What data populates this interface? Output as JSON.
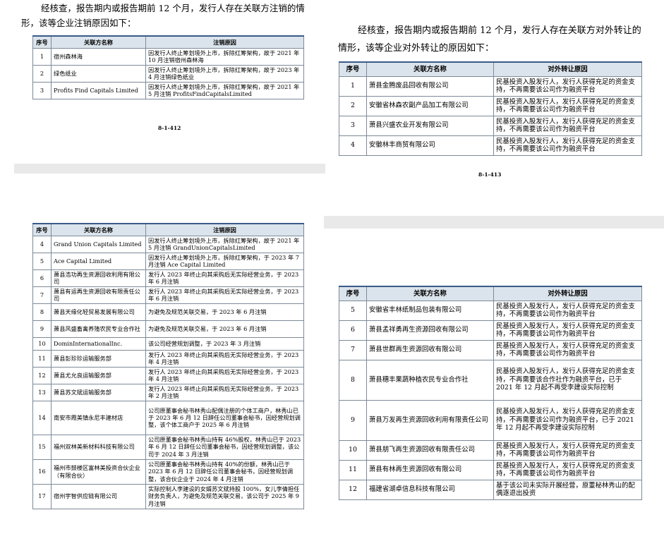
{
  "page_top_left": {
    "intro": "经核查，报告期内或报告期前 12 个月，发行人存在关联方注销的情形，该等企业注销原因如下：",
    "headers": [
      "序号",
      "关联方名称",
      "注销原因"
    ],
    "rows": [
      [
        "1",
        "宿州森林海",
        "因发行人终止筹划境外上市，拆除红筹架构，故于 2021 年 10 月注销宿州森林海"
      ],
      [
        "2",
        "绿色纸业",
        "因发行人终止筹划境外上市，拆除红筹架构，故于 2023 年 4 月注销绿色纸业"
      ],
      [
        "3",
        "Profits Find Capitals Limited",
        "因发行人终止筹划境外上市，拆除红筹架构，故于 2021 年 5 月注销 ProfitsFindCapitalsLimited"
      ]
    ],
    "page_number": "8-1-412"
  },
  "page_top_right": {
    "intro": "经核查，报告期内或报告期前 12 个月，发行人存在关联方对外转让的情形，该等企业对外转让的原因如下：",
    "headers": [
      "序号",
      "关联方名称",
      "对外转让原因"
    ],
    "rows": [
      [
        "1",
        "萧县金腾废品回收有限公司",
        "民基投资入股发行人，发行人获得充足的资金支持，不再需要该公司作为融资平台"
      ],
      [
        "2",
        "安徽省林森农副产品加工有限公司",
        "民基投资入股发行人，发行人获得充足的资金支持，不再需要该公司作为融资平台"
      ],
      [
        "3",
        "萧县兴盛农业开发有限公司",
        "民基投资入股发行人，发行人获得充足的资金支持，不再需要该公司作为融资平台"
      ],
      [
        "4",
        "安徽林丰商贸有限公司",
        "民基投资入股发行人，发行人获得充足的资金支持，不再需要该公司作为融资平台"
      ]
    ],
    "page_number": "8-1-413"
  },
  "page_bottom_left": {
    "headers": [
      "序号",
      "关联方名称",
      "注销原因"
    ],
    "rows": [
      [
        "4",
        "Grand Union Capitals Limited",
        "因发行人终止筹划境外上市，拆除红筹架构，故于 2021 年 5 月注销 GrandUnionCapitalsLimited"
      ],
      [
        "5",
        "Ace Capital Limited",
        "因发行人终止筹划境外上市，拆除红筹架构，于 2023 年 7 月注销 Ace Capital Limited"
      ],
      [
        "6",
        "萧县浩功再生资源回收利用有限公司",
        "发行人 2023 年终止向其采购后无实际经营业务，于 2023 年 6 月注销"
      ],
      [
        "7",
        "萧县有运再生资源回收有限责任公司",
        "发行人 2023 年终止向其采购后无实际经营业务，于 2023 年 6 月注销"
      ],
      [
        "8",
        "萧县天缘化轻贸易发展有限公司",
        "为避免及规范关联交易，于 2023 年 6 月注销"
      ],
      [
        "9",
        "萧县风盛畜禽养殖农民专业合作社",
        "为避免及规范关联交易，于 2023 年 6 月注销"
      ],
      [
        "10",
        "DominInternationalInc.",
        "该公司经营规划调整，于 2023 年 3 月注销"
      ],
      [
        "11",
        "萧县彭珍珍运输服务部",
        "发行人 2023 年终止向其采购后无实际经营业务，于 2023 年 4 月注销"
      ],
      [
        "12",
        "萧县尤允良运输服务部",
        "发行人 2023 年终止向其采购后无实际经营业务，于 2023 年 4 月注销"
      ],
      [
        "13",
        "萧县苏文斌运输服务部",
        "发行人 2023 年终止向其采购后无实际经营业务，于 2023 年 2 月注销"
      ],
      [
        "14",
        "南安市霞美镇永尼丰建材店",
        "公司原董事会秘书林秀山配偶注册的个体工商户，林秀山已于 2023 年 6 月 12 日辞任公司董事会秘书，因经营规划调整，该个体工商户于 2025 年 6 月注销"
      ],
      [
        "15",
        "福州双林美新材料科技有限公司",
        "公司原董事会秘书林秀山持有 46%股权，林秀山已于 2023 年 6 月 12 日辞任公司董事会秘书，因经营规划调整，该公司于 2024 年 3 月注销"
      ],
      [
        "16",
        "福州市鼓楼区富林美投资合伙企业（有限合伙）",
        "公司原董事会秘书林秀山持有 40%的份额，林秀山已于 2023 年 6 月 12 日辞任公司董事会秘书，因经营规划调整，该合伙企业于 2024 年 4 月注销"
      ],
      [
        "17",
        "宿州宇智供应链有限公司",
        "实际控制人李建设的女婿苏文斌持股 100%，女儿李倩担任财务负责人，为避免及规范关联交易，该公司于 2025 年 9 月注销"
      ]
    ]
  },
  "page_bottom_right": {
    "headers": [
      "序号",
      "关联方名称",
      "对外转让原因"
    ],
    "rows": [
      [
        "5",
        "安徽省丰林纸制品包装有限公司",
        "民基投资入股发行人，发行人获得充足的资金支持，不再需要该公司作为融资平台"
      ],
      [
        "6",
        "萧县孟祥勇再生资源回收有限公司",
        "民基投资入股发行人，发行人获得充足的资金支持，不再需要该公司作为融资平台"
      ],
      [
        "7",
        "萧县世群再生资源回收有限公司",
        "民基投资入股发行人，发行人获得充足的资金支持，不再需要该公司作为融资平台"
      ],
      [
        "8",
        "萧县穗丰果蔬种植农民专业合作社",
        "民基投资入股发行人，发行人获得充足的资金支持，不再需要该合作社作为融资平台，已于 2021 年 12 月起不再受李建设实际控制"
      ],
      [
        "9",
        "萧县万发再生资源回收利用有限责任公司",
        "民基投资入股发行人，发行人获得充足的资金支持，不再需要该公司作为融资平台，已于 2021 年 12 月起不再受李建设实际控制"
      ],
      [
        "10",
        "萧县朋飞再生资源回收有限责任公司",
        "民基投资入股发行人，发行人获得充足的资金支持，不再需要该公司作为融资平台"
      ],
      [
        "11",
        "萧县有林再生资源回收有限公司",
        "民基投资入股发行人，发行人获得充足的资金支持，不再需要该公司作为融资平台"
      ],
      [
        "12",
        "福建省湖卓信息科技有限公司",
        "基于该公司未实际开展经营，原董秘林秀山的配偶逐退出投资"
      ]
    ]
  }
}
